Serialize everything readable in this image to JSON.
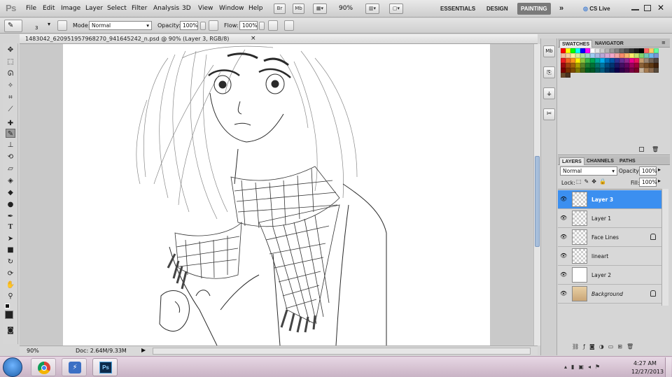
{
  "app": {
    "logo": "Ps"
  },
  "menu": [
    "File",
    "Edit",
    "Image",
    "Layer",
    "Select",
    "Filter",
    "Analysis",
    "3D",
    "View",
    "Window",
    "Help"
  ],
  "appbar": {
    "br_label": "Br",
    "mb_label": "Mb",
    "zoom": "90%",
    "workspaces": [
      "ESSENTIALS",
      "DESIGN",
      "PAINTING"
    ],
    "more": "»",
    "cs_live": "CS Live"
  },
  "options": {
    "brush_size": "3",
    "mode_label": "Mode:",
    "mode_value": "Normal",
    "opacity_label": "Opacity:",
    "opacity_value": "100%",
    "flow_label": "Flow:",
    "flow_value": "100%"
  },
  "document": {
    "tab_title": "1483042_620951957968270_941645242_n.psd @ 90% (Layer 3, RGB/8)",
    "close": "×"
  },
  "status": {
    "zoom": "90%",
    "doc": "Doc: 2.64M/9.33M"
  },
  "swatches_panel": {
    "tabs": [
      "SWATCHES",
      "NAVIGATOR"
    ],
    "colors": [
      "#ff0000",
      "#ffff00",
      "#00ff00",
      "#00ffff",
      "#0000ff",
      "#ff00ff",
      "#ffffff",
      "#e6e6e6",
      "#cccccc",
      "#b3b3b3",
      "#999999",
      "#808080",
      "#666666",
      "#4d4d4d",
      "#333333",
      "#1a1a1a",
      "#000000",
      "#ff6666",
      "#ffcc66",
      "#66ff99",
      "#f7b89d",
      "#f9cf9d",
      "#fbf19d",
      "#d6ec9d",
      "#a9e29f",
      "#9ed8c9",
      "#9fcdf3",
      "#a8b7e2",
      "#b8a7d6",
      "#d8a8d6",
      "#f2a7c9",
      "#f5a5a5",
      "#f78b6b",
      "#f9b56b",
      "#fbec6b",
      "#c6e36b",
      "#80d26f",
      "#6fc7b3",
      "#6eb7ec",
      "#7a95d4",
      "#ed1c24",
      "#f26522",
      "#f7941d",
      "#fff200",
      "#8dc63f",
      "#39b54a",
      "#00a651",
      "#00a99d",
      "#00aeef",
      "#0072bc",
      "#0054a6",
      "#2e3192",
      "#662d91",
      "#92278f",
      "#ec008c",
      "#ed145b",
      "#c69c6d",
      "#998675",
      "#736357",
      "#534741",
      "#9e0b0f",
      "#a0410d",
      "#a36209",
      "#aba000",
      "#598527",
      "#1a7b30",
      "#007236",
      "#00746b",
      "#0076a3",
      "#004b80",
      "#003471",
      "#1b1464",
      "#440e62",
      "#630460",
      "#9e005d",
      "#9e0039",
      "#8c6239",
      "#754c24",
      "#603913",
      "#42210b",
      "#790000",
      "#7b2e00",
      "#7d4900",
      "#827b00",
      "#406618",
      "#005e20",
      "#005826",
      "#005952",
      "#005b7f",
      "#003663",
      "#002157",
      "#0d004c",
      "#32004b",
      "#4b0049",
      "#7b0046",
      "#7a0026",
      "#c7b299",
      "#a67c52",
      "#8c6b4f",
      "#594a3c"
    ],
    "extras": [
      "#6b4a2b",
      "#4a3220"
    ]
  },
  "layers_panel": {
    "tabs": [
      "LAYERS",
      "CHANNELS",
      "PATHS"
    ],
    "blend": "Normal",
    "opacity_label": "Opacity:",
    "opacity_value": "100%",
    "lock_label": "Lock:",
    "fill_label": "Fill:",
    "fill_value": "100%",
    "layers": [
      {
        "name": "Layer 3",
        "selected": true,
        "locked": false,
        "thumb": "checker"
      },
      {
        "name": "Layer 1",
        "selected": false,
        "locked": false,
        "thumb": "checker"
      },
      {
        "name": "Face Lines",
        "selected": false,
        "locked": true,
        "thumb": "checker"
      },
      {
        "name": "lineart",
        "selected": false,
        "locked": false,
        "thumb": "checker"
      },
      {
        "name": "Layer 2",
        "selected": false,
        "locked": false,
        "thumb": "white"
      },
      {
        "name": "Background",
        "selected": false,
        "locked": true,
        "thumb": "paper"
      }
    ]
  },
  "taskbar": {
    "apps": [
      "start-orb",
      "chrome",
      "messenger",
      "photoshop"
    ],
    "time": "4:27 AM",
    "date": "12/27/2013"
  }
}
